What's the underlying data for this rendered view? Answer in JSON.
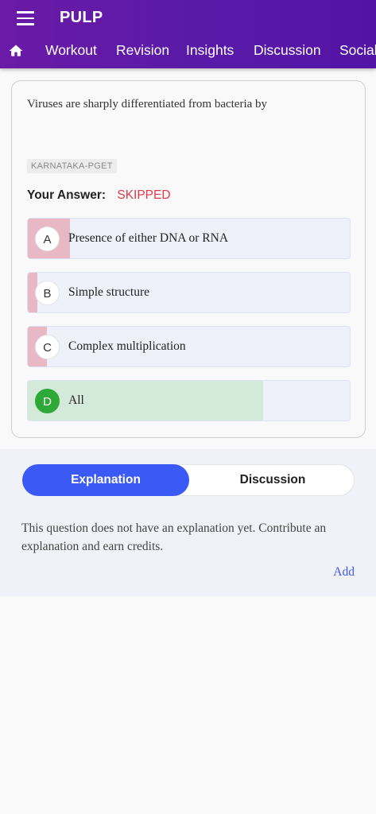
{
  "app": {
    "title": "PULP"
  },
  "nav": {
    "tabs": [
      {
        "label": "Workout"
      },
      {
        "label": "Revision"
      },
      {
        "label": "Insights"
      },
      {
        "label": "Discussion"
      },
      {
        "label": "Social"
      }
    ]
  },
  "question": {
    "text": "Viruses are sharply differentiated from bacteria by",
    "tag": "KARNATAKA-PGET",
    "answer_label": "Your Answer:",
    "answer_value": "SKIPPED",
    "options": [
      {
        "letter": "A",
        "text": "Presence of either DNA or RNA",
        "percent": 13,
        "correct": false
      },
      {
        "letter": "B",
        "text": "Simple structure",
        "percent": 3,
        "correct": false
      },
      {
        "letter": "C",
        "text": "Complex multiplication",
        "percent": 6,
        "correct": false
      },
      {
        "letter": "D",
        "text": "All",
        "percent": 73,
        "correct": true
      }
    ]
  },
  "tabs": {
    "explanation": "Explanation",
    "discussion": "Discussion"
  },
  "explanation": {
    "text": "This question does not have an explanation yet. Contribute an explanation and earn credits.",
    "add_label": "Add"
  },
  "colors": {
    "wrong_fill": "#e8b8c4",
    "correct_fill": "#d2ead7",
    "accent": "#3b5af5"
  }
}
